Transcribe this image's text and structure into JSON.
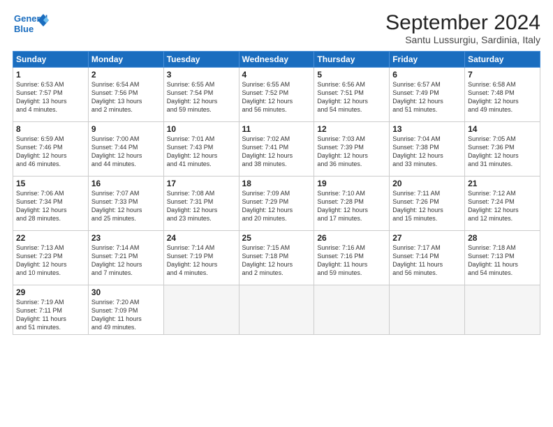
{
  "logo": {
    "line1": "General",
    "line2": "Blue"
  },
  "title": "September 2024",
  "subtitle": "Santu Lussurgiu, Sardinia, Italy",
  "days_of_week": [
    "Sunday",
    "Monday",
    "Tuesday",
    "Wednesday",
    "Thursday",
    "Friday",
    "Saturday"
  ],
  "weeks": [
    [
      {
        "day": 1,
        "info": "Sunrise: 6:53 AM\nSunset: 7:57 PM\nDaylight: 13 hours\nand 4 minutes."
      },
      {
        "day": 2,
        "info": "Sunrise: 6:54 AM\nSunset: 7:56 PM\nDaylight: 13 hours\nand 2 minutes."
      },
      {
        "day": 3,
        "info": "Sunrise: 6:55 AM\nSunset: 7:54 PM\nDaylight: 12 hours\nand 59 minutes."
      },
      {
        "day": 4,
        "info": "Sunrise: 6:55 AM\nSunset: 7:52 PM\nDaylight: 12 hours\nand 56 minutes."
      },
      {
        "day": 5,
        "info": "Sunrise: 6:56 AM\nSunset: 7:51 PM\nDaylight: 12 hours\nand 54 minutes."
      },
      {
        "day": 6,
        "info": "Sunrise: 6:57 AM\nSunset: 7:49 PM\nDaylight: 12 hours\nand 51 minutes."
      },
      {
        "day": 7,
        "info": "Sunrise: 6:58 AM\nSunset: 7:48 PM\nDaylight: 12 hours\nand 49 minutes."
      }
    ],
    [
      {
        "day": 8,
        "info": "Sunrise: 6:59 AM\nSunset: 7:46 PM\nDaylight: 12 hours\nand 46 minutes."
      },
      {
        "day": 9,
        "info": "Sunrise: 7:00 AM\nSunset: 7:44 PM\nDaylight: 12 hours\nand 44 minutes."
      },
      {
        "day": 10,
        "info": "Sunrise: 7:01 AM\nSunset: 7:43 PM\nDaylight: 12 hours\nand 41 minutes."
      },
      {
        "day": 11,
        "info": "Sunrise: 7:02 AM\nSunset: 7:41 PM\nDaylight: 12 hours\nand 38 minutes."
      },
      {
        "day": 12,
        "info": "Sunrise: 7:03 AM\nSunset: 7:39 PM\nDaylight: 12 hours\nand 36 minutes."
      },
      {
        "day": 13,
        "info": "Sunrise: 7:04 AM\nSunset: 7:38 PM\nDaylight: 12 hours\nand 33 minutes."
      },
      {
        "day": 14,
        "info": "Sunrise: 7:05 AM\nSunset: 7:36 PM\nDaylight: 12 hours\nand 31 minutes."
      }
    ],
    [
      {
        "day": 15,
        "info": "Sunrise: 7:06 AM\nSunset: 7:34 PM\nDaylight: 12 hours\nand 28 minutes."
      },
      {
        "day": 16,
        "info": "Sunrise: 7:07 AM\nSunset: 7:33 PM\nDaylight: 12 hours\nand 25 minutes."
      },
      {
        "day": 17,
        "info": "Sunrise: 7:08 AM\nSunset: 7:31 PM\nDaylight: 12 hours\nand 23 minutes."
      },
      {
        "day": 18,
        "info": "Sunrise: 7:09 AM\nSunset: 7:29 PM\nDaylight: 12 hours\nand 20 minutes."
      },
      {
        "day": 19,
        "info": "Sunrise: 7:10 AM\nSunset: 7:28 PM\nDaylight: 12 hours\nand 17 minutes."
      },
      {
        "day": 20,
        "info": "Sunrise: 7:11 AM\nSunset: 7:26 PM\nDaylight: 12 hours\nand 15 minutes."
      },
      {
        "day": 21,
        "info": "Sunrise: 7:12 AM\nSunset: 7:24 PM\nDaylight: 12 hours\nand 12 minutes."
      }
    ],
    [
      {
        "day": 22,
        "info": "Sunrise: 7:13 AM\nSunset: 7:23 PM\nDaylight: 12 hours\nand 10 minutes."
      },
      {
        "day": 23,
        "info": "Sunrise: 7:14 AM\nSunset: 7:21 PM\nDaylight: 12 hours\nand 7 minutes."
      },
      {
        "day": 24,
        "info": "Sunrise: 7:14 AM\nSunset: 7:19 PM\nDaylight: 12 hours\nand 4 minutes."
      },
      {
        "day": 25,
        "info": "Sunrise: 7:15 AM\nSunset: 7:18 PM\nDaylight: 12 hours\nand 2 minutes."
      },
      {
        "day": 26,
        "info": "Sunrise: 7:16 AM\nSunset: 7:16 PM\nDaylight: 11 hours\nand 59 minutes."
      },
      {
        "day": 27,
        "info": "Sunrise: 7:17 AM\nSunset: 7:14 PM\nDaylight: 11 hours\nand 56 minutes."
      },
      {
        "day": 28,
        "info": "Sunrise: 7:18 AM\nSunset: 7:13 PM\nDaylight: 11 hours\nand 54 minutes."
      }
    ],
    [
      {
        "day": 29,
        "info": "Sunrise: 7:19 AM\nSunset: 7:11 PM\nDaylight: 11 hours\nand 51 minutes."
      },
      {
        "day": 30,
        "info": "Sunrise: 7:20 AM\nSunset: 7:09 PM\nDaylight: 11 hours\nand 49 minutes."
      },
      null,
      null,
      null,
      null,
      null
    ]
  ]
}
